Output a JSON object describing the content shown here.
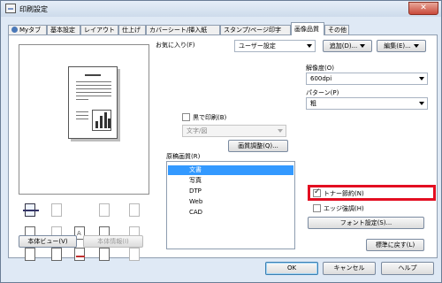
{
  "window": {
    "title": "印刷設定",
    "close_label": "✕"
  },
  "tabs": [
    {
      "label": "Myタブ",
      "active": false
    },
    {
      "label": "基本設定",
      "active": false
    },
    {
      "label": "レイアウト",
      "active": false
    },
    {
      "label": "仕上げ",
      "active": false
    },
    {
      "label": "カバーシート/挿入紙",
      "active": false
    },
    {
      "label": "スタンプ/ページ印字",
      "active": false
    },
    {
      "label": "画像品質",
      "active": true
    },
    {
      "label": "その他",
      "active": false
    }
  ],
  "favorites": {
    "label": "お気に入り(F)",
    "value": "ユーザー設定",
    "add_label": "追加(D)...",
    "edit_label": "編集(E)..."
  },
  "resolution": {
    "label": "解像度(O)",
    "value": "600dpi"
  },
  "pattern": {
    "label": "パターン(P)",
    "value": "粗"
  },
  "black_print": {
    "label": "黒で印刷(B)",
    "checked": false,
    "dropdown_value": "文字/図"
  },
  "quality_adjust_label": "画質調整(Q)...",
  "original_quality": {
    "label": "原稿画質(R)",
    "items": [
      "文書",
      "写真",
      "DTP",
      "Web",
      "CAD"
    ],
    "selected_index": 0
  },
  "toner_save": {
    "label": "トナー節約(N)",
    "checked": true
  },
  "edge_enhance": {
    "label": "エッジ強調(H)",
    "checked": false
  },
  "font_settings_label": "フォント設定(S)...",
  "preview_buttons": {
    "view_label": "本体ビュー(V)",
    "info_label": "本体情報(I)"
  },
  "restore_defaults_label": "標準に戻す(L)",
  "footer": {
    "ok_label": "OK",
    "cancel_label": "キャンセル",
    "help_label": "ヘルプ"
  },
  "colors": {
    "highlight": "#e30e21",
    "selection": "#3399ff",
    "window_frame": "#dfe9f5"
  }
}
